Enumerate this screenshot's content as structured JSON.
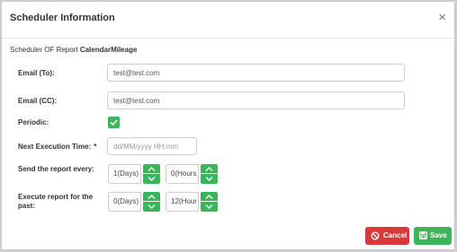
{
  "modal": {
    "title": "Scheduler Information",
    "close_symbol": "×",
    "subtitle_prefix": "Scheduler OF Report",
    "report_name": "CalendarMileage"
  },
  "form": {
    "email_to": {
      "label": "Email (To):",
      "value": "test@test.com"
    },
    "email_cc": {
      "label": "Email (CC):",
      "value": "test@test.com"
    },
    "periodic": {
      "label": "Periodic:",
      "checked": true
    },
    "next_execution": {
      "label": "Next Execution Time:",
      "required_mark": "*",
      "placeholder": "dd/MM/yyyy HH:mm",
      "value": ""
    },
    "send_every": {
      "label": "Send the report every:",
      "days": "1(Days)",
      "hours": "0(Hours"
    },
    "execute_past": {
      "label_line1": "Execute report for the",
      "label_line2": "past:",
      "days": "0(Days)",
      "hours": "12(Hour"
    }
  },
  "footer": {
    "cancel_label": "Cancel",
    "save_label": "Save"
  },
  "colors": {
    "success": "#3cb55a",
    "danger": "#d9393a"
  }
}
